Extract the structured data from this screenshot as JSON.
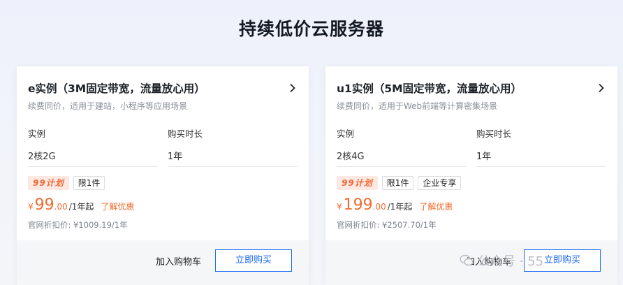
{
  "page": {
    "title": "持续低价云服务器"
  },
  "cards": [
    {
      "title": "e实例（3M固定带宽，流量放心用）",
      "subtitle": "续费同价，适用于建站，小程序等应用场景",
      "spec_a_label": "实例",
      "spec_a_value": "2核2G",
      "spec_b_label": "购买时长",
      "spec_b_value": "1年",
      "tag_plan": "99计划",
      "tag_limit": "限1件",
      "currency": "¥",
      "price_int": "99",
      "price_dec": ".00",
      "price_unit": "/1年起",
      "promo": "了解优惠",
      "original": "官网折扣价: ¥1009.19/1年",
      "cart": "加入购物车",
      "buy": "立即购买"
    },
    {
      "title": "u1实例（5M固定带宽，流量放心用）",
      "subtitle": "续费同价，适用于Web前端等计算密集场景",
      "spec_a_label": "实例",
      "spec_a_value": "2核4G",
      "spec_b_label": "购买时长",
      "spec_b_value": "1年",
      "tag_plan": "99计划",
      "tag_limit": "限1件",
      "tag_extra": "企业专享",
      "currency": "¥",
      "price_int": "199",
      "price_dec": ".00",
      "price_unit": "/1年起",
      "promo": "了解优惠",
      "original": "官网折扣价: ¥2507.70/1年",
      "cart": "加入购物车",
      "buy": "立即购买"
    }
  ],
  "watermark": {
    "text": "公众号 · 55"
  },
  "colors": {
    "accent_orange": "#f26b2d",
    "accent_blue": "#1b6af5"
  },
  "icons": {
    "card_arrow": "chevron-right-icon",
    "watermark": "wechat-icon"
  }
}
